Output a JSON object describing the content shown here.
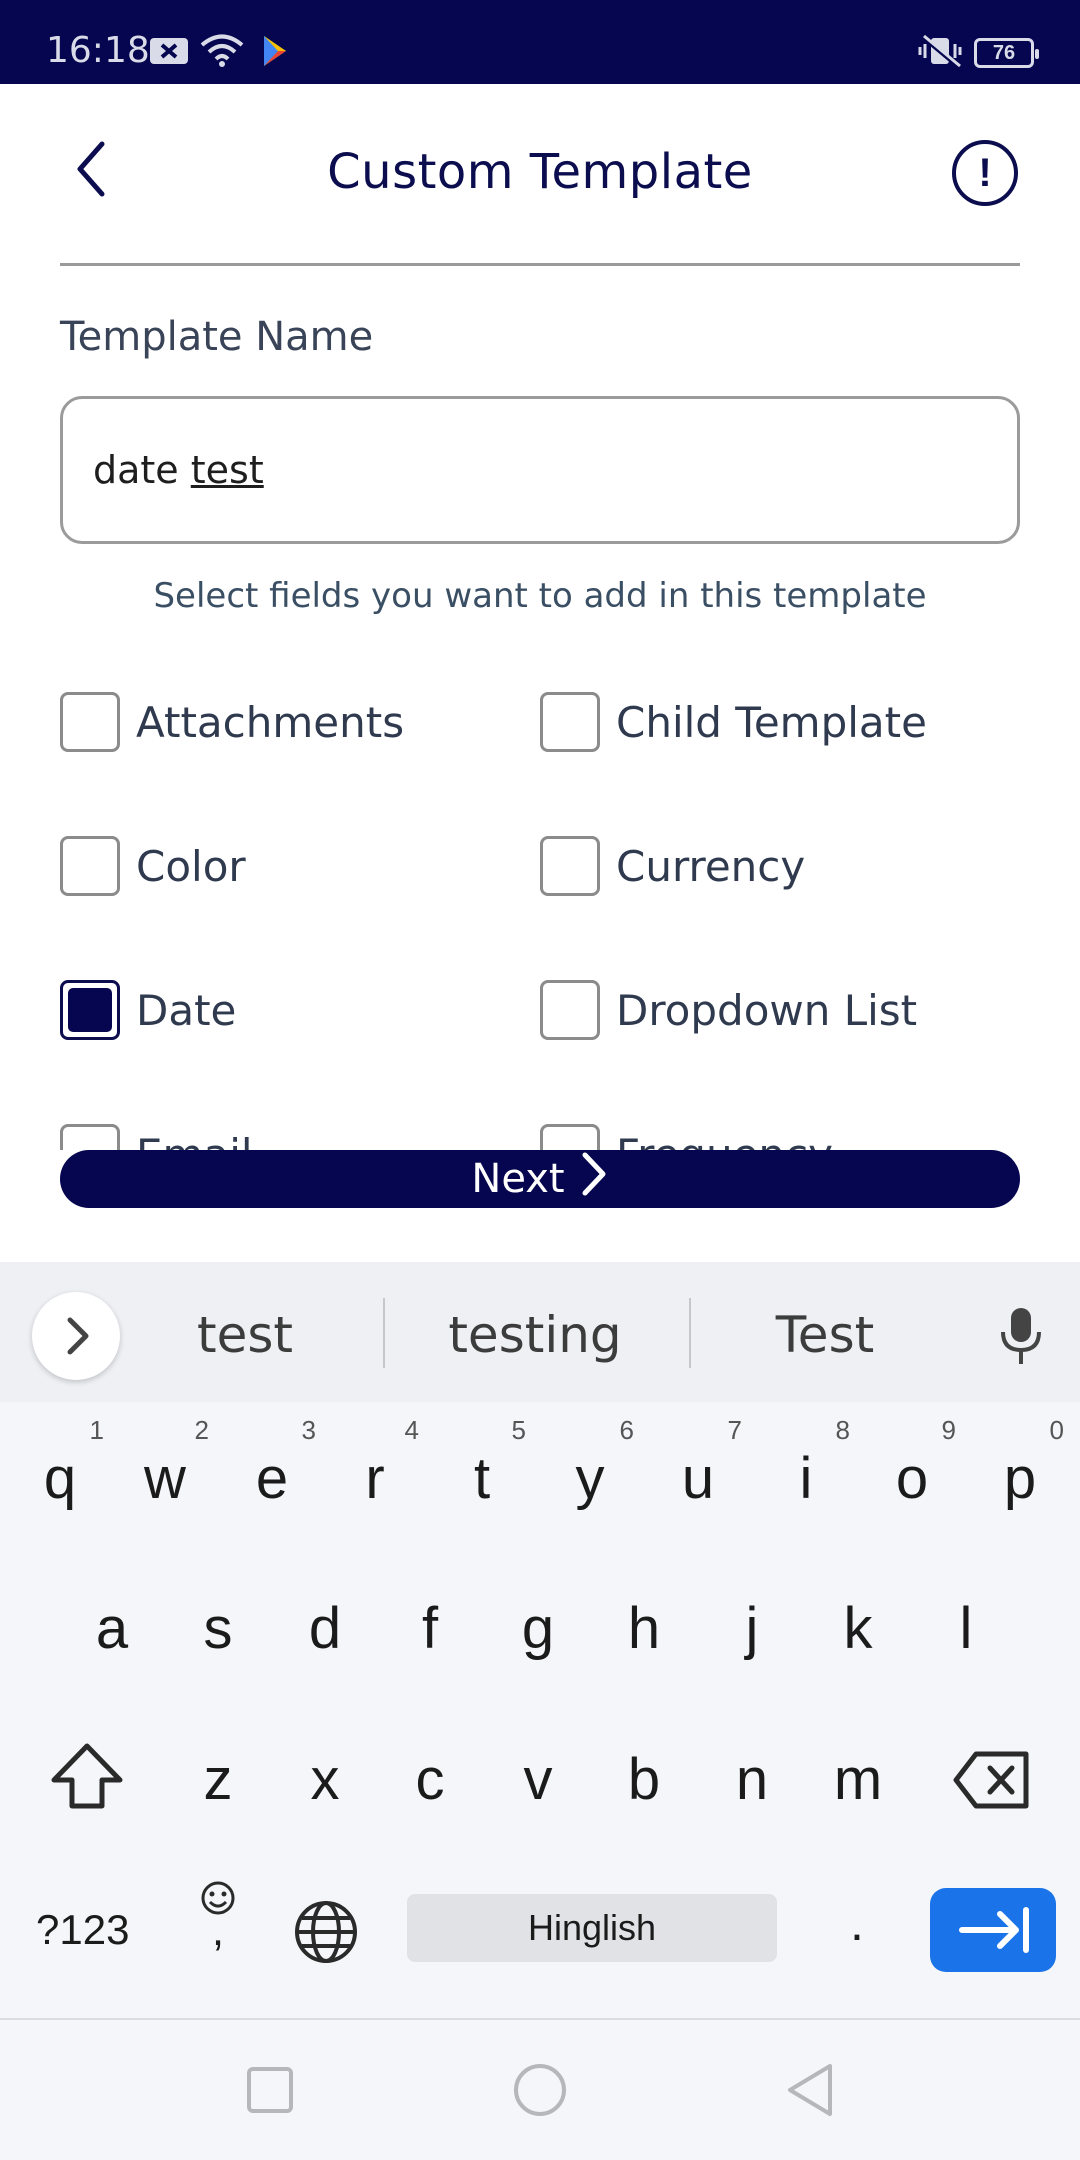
{
  "status_bar": {
    "time": "16:18",
    "battery": "76"
  },
  "header": {
    "title": "Custom Template"
  },
  "form": {
    "name_label": "Template Name",
    "name_value_plain": "date ",
    "name_value_underlined": "test",
    "hint": "Select fields you want to add in this template",
    "fields": [
      {
        "label": "Attachments",
        "checked": false
      },
      {
        "label": "Child Template",
        "checked": false
      },
      {
        "label": "Color",
        "checked": false
      },
      {
        "label": "Currency",
        "checked": false
      },
      {
        "label": "Date",
        "checked": true
      },
      {
        "label": "Dropdown List",
        "checked": false
      },
      {
        "label": "Email",
        "checked": false
      },
      {
        "label": "Frequency",
        "checked": false
      }
    ],
    "next_label": "Next"
  },
  "keyboard": {
    "suggestions": [
      "test",
      "testing",
      "Test"
    ],
    "row1": [
      "q",
      "w",
      "e",
      "r",
      "t",
      "y",
      "u",
      "i",
      "o",
      "p"
    ],
    "row1_hints": [
      "1",
      "2",
      "3",
      "4",
      "5",
      "6",
      "7",
      "8",
      "9",
      "0"
    ],
    "row2": [
      "a",
      "s",
      "d",
      "f",
      "g",
      "h",
      "j",
      "k",
      "l"
    ],
    "row3": [
      "z",
      "x",
      "c",
      "v",
      "b",
      "n",
      "m"
    ],
    "symbols_key": "?123",
    "comma_key": ",",
    "period_key": ".",
    "space_label": "Hinglish"
  },
  "colors": {
    "primary": "#05064f",
    "enter_key": "#1a73e8"
  }
}
